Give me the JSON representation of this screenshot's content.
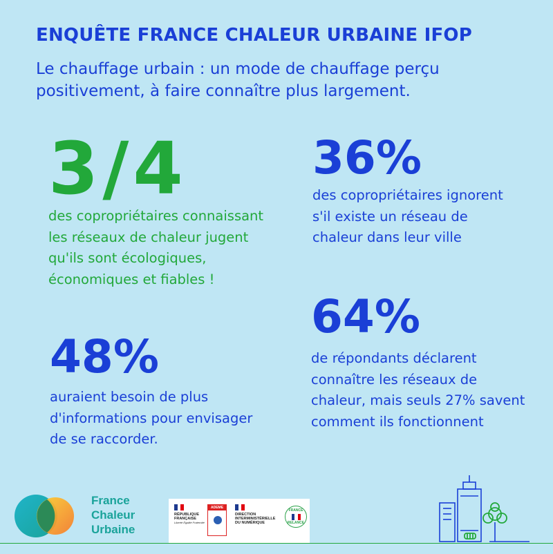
{
  "header": {
    "title": "ENQUÊTE FRANCE CHALEUR URBAINE IFOP",
    "subtitle": "Le chauffage urbain : un mode de chauffage perçu positivement, à faire connaître plus largement."
  },
  "stats": [
    {
      "value": "3/4",
      "text": "des copropriétaires connaissant les réseaux de chaleur jugent qu'ils sont écologiques, économiques et fiables !",
      "color": "#22a83a"
    },
    {
      "value": "36%",
      "text": "des copropriétaires ignorent s'il existe un réseau de chaleur dans leur ville",
      "color": "#1a3fd6"
    },
    {
      "value": "48%",
      "text": "auraient besoin de plus d'informations pour envisager de se raccorder.",
      "color": "#1a3fd6"
    },
    {
      "value": "64%",
      "text": "de répondants déclarent connaître les réseaux de chaleur, mais seuls 27% savent comment ils fonctionnent",
      "color": "#1a3fd6"
    }
  ],
  "footer": {
    "brand": {
      "line1": "France",
      "line2": "Chaleur",
      "line3": "Urbaine",
      "logo_icon": "overlapping-circles-logo",
      "color": "#1aa39a"
    },
    "partners": {
      "republique_line1": "RÉPUBLIQUE",
      "republique_line2": "FRANÇAISE",
      "republique_motto": "Liberté Égalité Fraternité",
      "ademe_label": "ADEME",
      "dinum_line1": "DIRECTION",
      "dinum_line2": "INTERMINISTÉRIELLE",
      "dinum_line3": "DU NUMÉRIQUE",
      "relance_top": "FRANCE",
      "relance_bottom": "RELANCE"
    },
    "city_icon": "city-buildings-tree-icon"
  },
  "colors": {
    "background": "#bfe6f4",
    "blue": "#1a3fd6",
    "green": "#22a83a"
  }
}
